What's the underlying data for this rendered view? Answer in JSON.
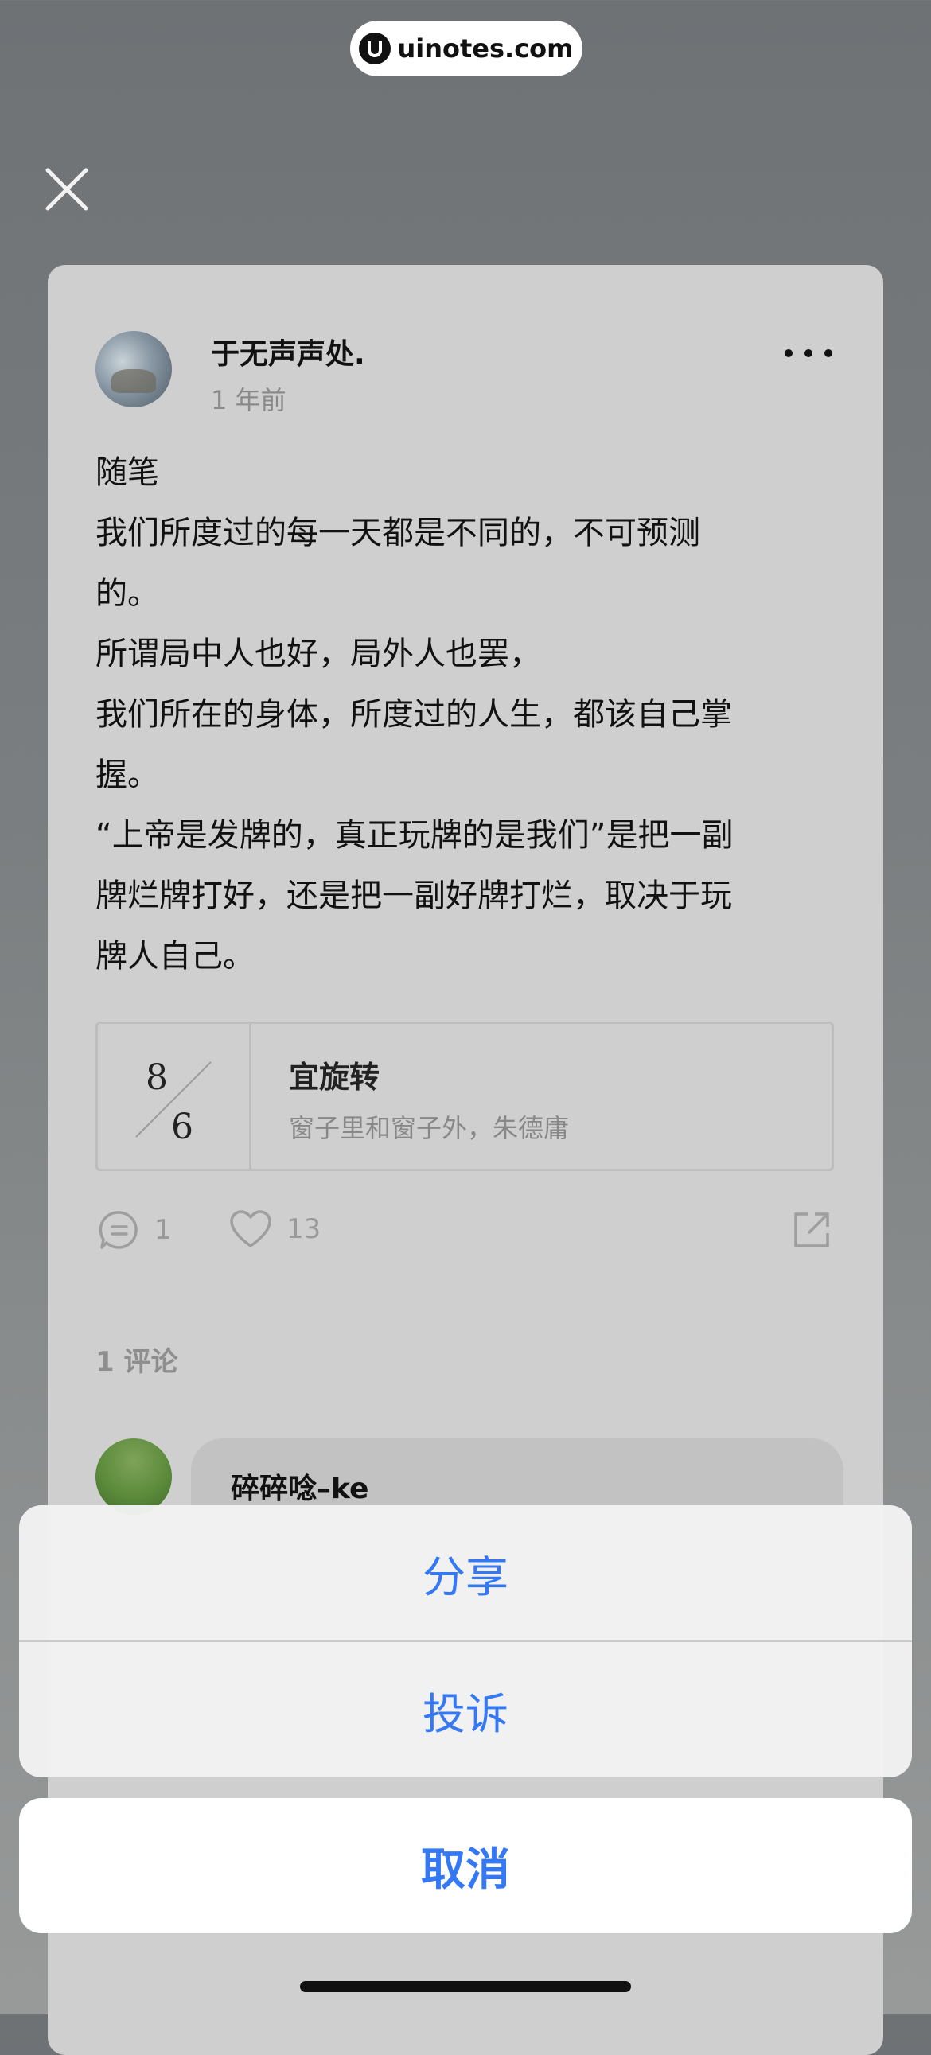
{
  "watermark": {
    "text": "uinotes.com"
  },
  "post": {
    "author": "于无声声处.",
    "time": "1 年前",
    "body_lines": [
      "随笔",
      "我们所度过的每一天都是不同的，不可预测",
      "的。",
      "所谓局中人也好，局外人也罢，",
      "我们所在的身体，所度过的人生，都该自己掌",
      "握。",
      "“上帝是发牌的，真正玩牌的是我们”是把一副",
      "牌烂牌打好，还是把一副好牌打烂，取决于玩",
      "牌人自己。"
    ],
    "card": {
      "month": "8",
      "day": "6",
      "title": "宜旋转",
      "subtitle": "窗子里和窗子外，朱德庸"
    },
    "comments_count": "1",
    "likes_count": "13"
  },
  "comments": {
    "header": "1 评论",
    "first": {
      "author": "碎碎唸–ke"
    }
  },
  "action_sheet": {
    "share": "分享",
    "report": "投诉",
    "cancel": "取消"
  },
  "colors": {
    "accent": "#3478f6",
    "card_bg": "#cfcfcf",
    "overlay": "#6e7275"
  }
}
